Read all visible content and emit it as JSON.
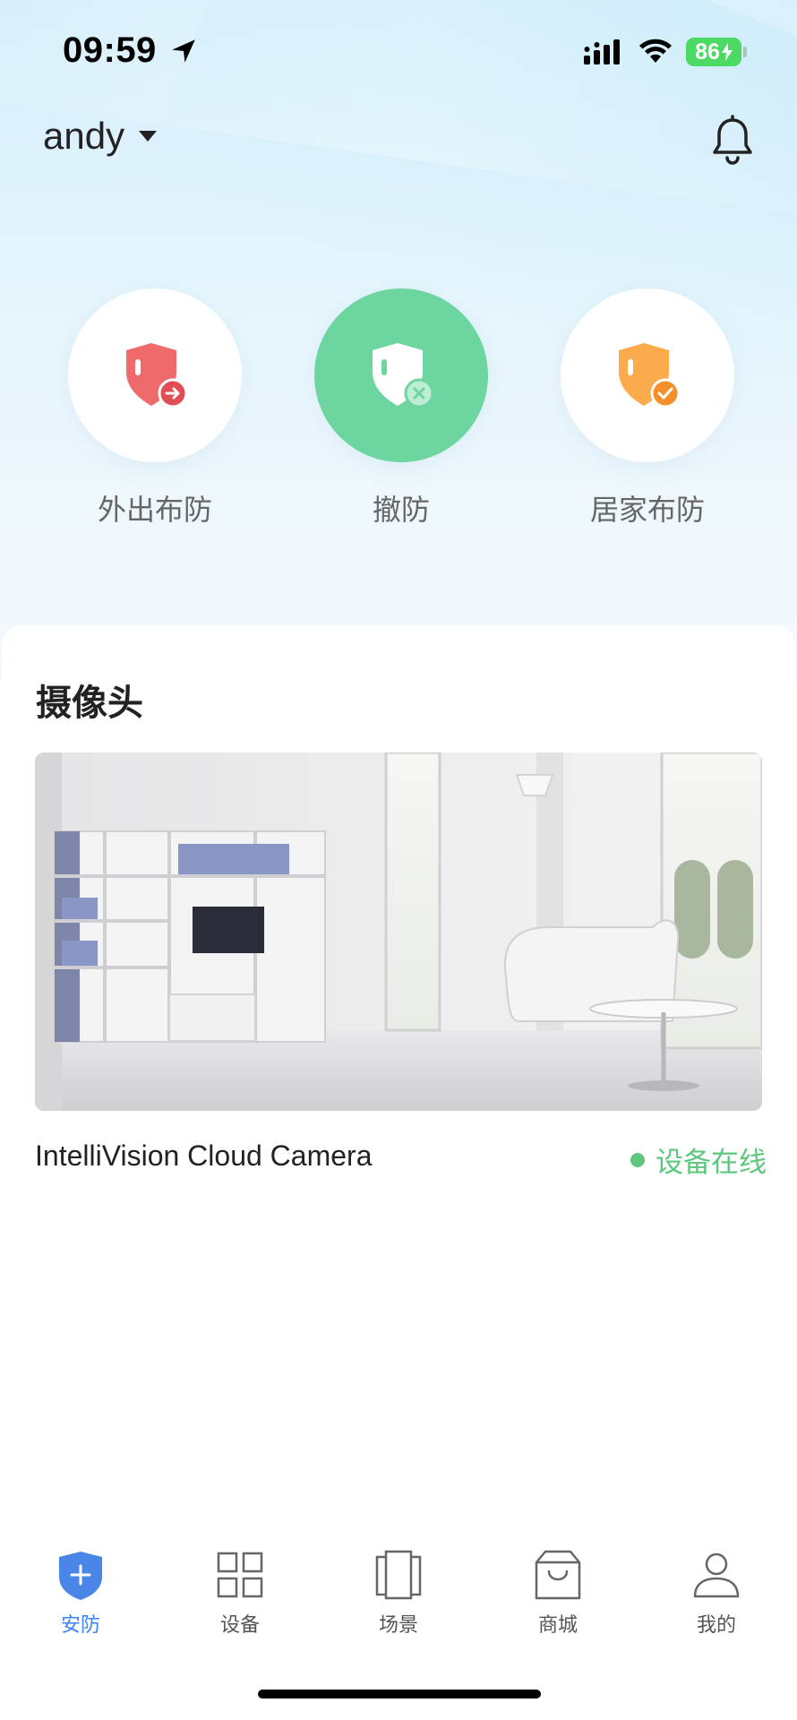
{
  "status_bar": {
    "time": "09:59",
    "battery": "86"
  },
  "header": {
    "user": "andy"
  },
  "modes": [
    {
      "label": "外出布防",
      "color": "#ef6a6a"
    },
    {
      "label": "撤防",
      "color": "#6dd6a0"
    },
    {
      "label": "居家布防",
      "color": "#fbab4c"
    }
  ],
  "section": {
    "title": "摄像头"
  },
  "camera": {
    "name": "IntelliVision Cloud Camera",
    "status": "设备在线",
    "status_color": "#5cc77d"
  },
  "nav": {
    "items": [
      {
        "label": "安防",
        "icon": "shield-plus-icon"
      },
      {
        "label": "设备",
        "icon": "grid-icon"
      },
      {
        "label": "场景",
        "icon": "layers-icon"
      },
      {
        "label": "商城",
        "icon": "shopping-bag-icon"
      },
      {
        "label": "我的",
        "icon": "person-icon"
      }
    ],
    "active_color": "#3b82f6"
  }
}
